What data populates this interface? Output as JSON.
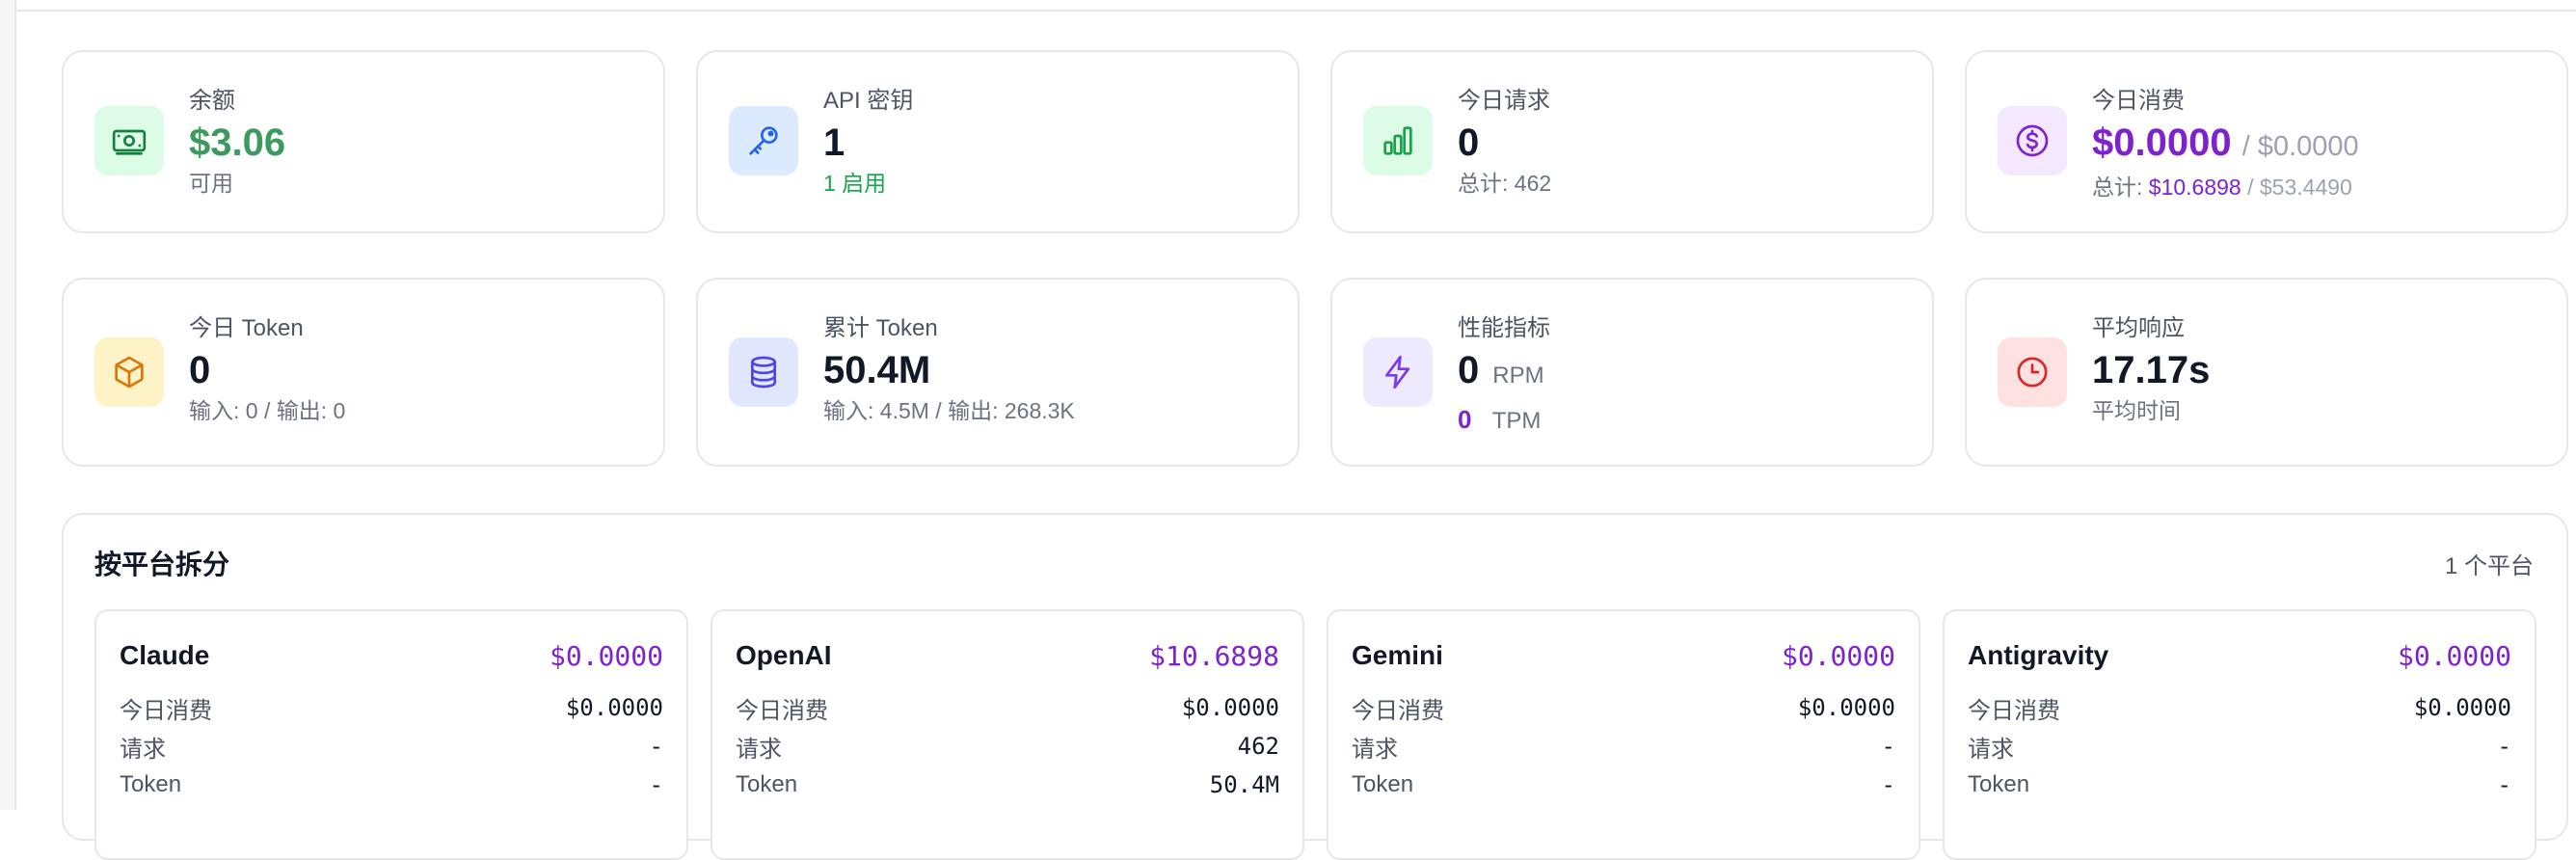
{
  "stats": {
    "balance": {
      "label": "余额",
      "value": "$3.06",
      "sub": "可用",
      "icon": "money-icon",
      "icon_bg": "#dcfce7",
      "icon_color": "#15803d"
    },
    "api_keys": {
      "label": "API 密钥",
      "value": "1",
      "sub": "1 启用",
      "icon": "key-icon",
      "icon_bg": "#dbeafe",
      "icon_color": "#2563eb"
    },
    "today_requests": {
      "label": "今日请求",
      "value": "0",
      "sub": "总计: 462",
      "icon": "bar-chart-icon",
      "icon_bg": "#dcfce7",
      "icon_color": "#16a34a"
    },
    "today_cost": {
      "label": "今日消费",
      "value": "$0.0000",
      "value_secondary": "/ $0.0000",
      "sub_prefix": "总计:",
      "sub_total": "$10.6898",
      "sub_secondary": "/ $53.4490",
      "icon": "dollar-circle-icon",
      "icon_bg": "#f3e8ff",
      "icon_color": "#7e22ce"
    },
    "today_tokens": {
      "label": "今日 Token",
      "value": "0",
      "sub": "输入: 0 / 输出: 0",
      "icon": "cube-icon",
      "icon_bg": "#fef3c7",
      "icon_color": "#d97706"
    },
    "total_tokens": {
      "label": "累计 Token",
      "value": "50.4M",
      "sub": "输入: 4.5M / 输出: 268.3K",
      "icon": "database-icon",
      "icon_bg": "#e0e7ff",
      "icon_color": "#4f46e5"
    },
    "performance": {
      "label": "性能指标",
      "rpm_value": "0",
      "rpm_unit": "RPM",
      "tpm_value": "0",
      "tpm_unit": "TPM",
      "icon": "lightning-icon",
      "icon_bg": "#ede9fe",
      "icon_color": "#7c3aed"
    },
    "avg_response": {
      "label": "平均响应",
      "value": "17.17s",
      "sub": "平均时间",
      "icon": "clock-icon",
      "icon_bg": "#fee2e2",
      "icon_color": "#dc2626"
    }
  },
  "breakdown": {
    "title": "按平台拆分",
    "count": "1 个平台",
    "row_labels": {
      "today_cost": "今日消费",
      "requests": "请求",
      "tokens": "Token"
    },
    "platforms": [
      {
        "name": "Claude",
        "total": "$0.0000",
        "today_cost": "$0.0000",
        "requests": "-",
        "tokens": "-"
      },
      {
        "name": "OpenAI",
        "total": "$10.6898",
        "today_cost": "$0.0000",
        "requests": "462",
        "tokens": "50.4M"
      },
      {
        "name": "Gemini",
        "total": "$0.0000",
        "today_cost": "$0.0000",
        "requests": "-",
        "tokens": "-"
      },
      {
        "name": "Antigravity",
        "total": "$0.0000",
        "today_cost": "$0.0000",
        "requests": "-",
        "tokens": "-"
      }
    ]
  }
}
